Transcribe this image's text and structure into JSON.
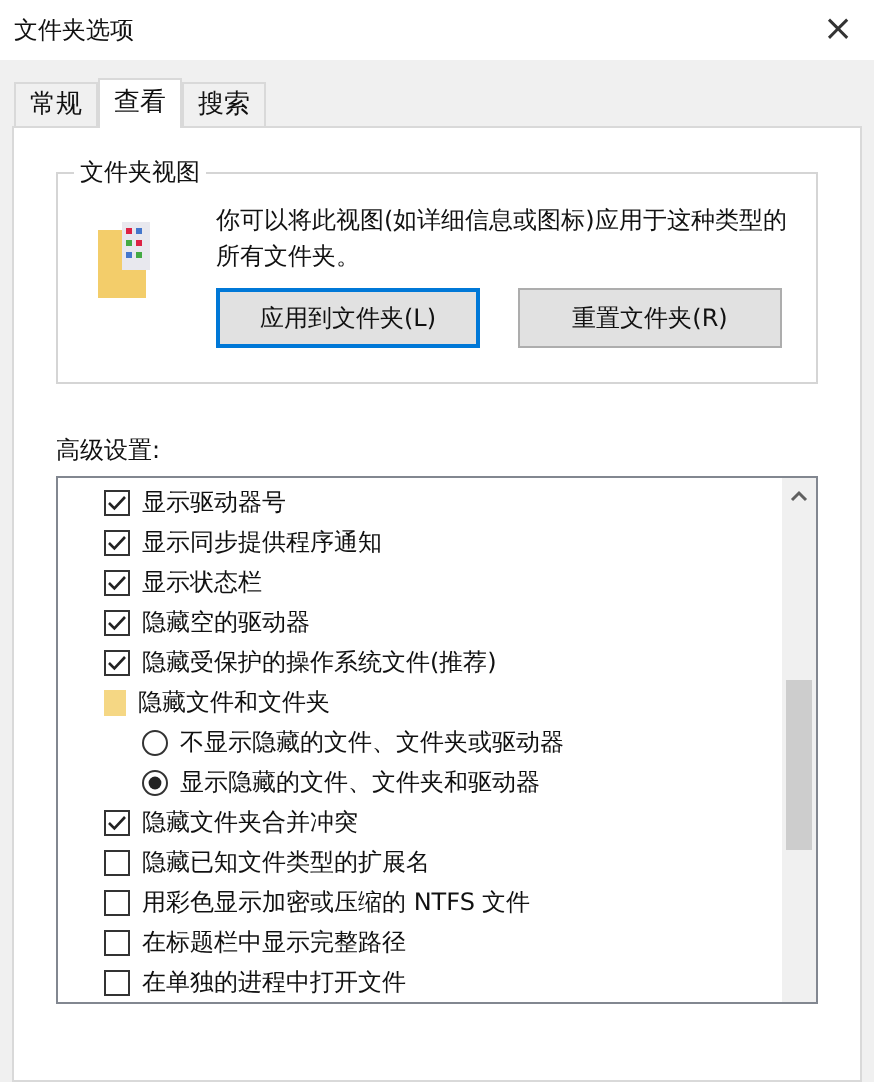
{
  "window": {
    "title": "文件夹选项",
    "close": "×"
  },
  "tabs": [
    {
      "label": "常规",
      "selected": false
    },
    {
      "label": "查看",
      "selected": true
    },
    {
      "label": "搜索",
      "selected": false
    }
  ],
  "folder_views": {
    "title": "文件夹视图",
    "description": "你可以将此视图(如详细信息或图标)应用于这种类型的所有文件夹。",
    "buttons": [
      {
        "label": "应用到文件夹(L)",
        "focused": true
      },
      {
        "label": "重置文件夹(R)",
        "focused": false
      }
    ]
  },
  "advanced": {
    "label": "高级设置:",
    "items": [
      {
        "kind": "checkbox",
        "label": "显示驱动器号",
        "checked": true
      },
      {
        "kind": "checkbox",
        "label": "显示同步提供程序通知",
        "checked": true
      },
      {
        "kind": "checkbox",
        "label": "显示状态栏",
        "checked": true
      },
      {
        "kind": "checkbox",
        "label": "隐藏空的驱动器",
        "checked": true
      },
      {
        "kind": "checkbox",
        "label": "隐藏受保护的操作系统文件(推荐)",
        "checked": true
      },
      {
        "kind": "folder",
        "label": "隐藏文件和文件夹",
        "children": [
          {
            "kind": "radio",
            "label": "不显示隐藏的文件、文件夹或驱动器",
            "selected": false
          },
          {
            "kind": "radio",
            "label": "显示隐藏的文件、文件夹和驱动器",
            "selected": true
          }
        ]
      },
      {
        "kind": "checkbox",
        "label": "隐藏文件夹合并冲突",
        "checked": true
      },
      {
        "kind": "checkbox",
        "label": "隐藏已知文件类型的扩展名",
        "checked": false
      },
      {
        "kind": "checkbox",
        "label": "用彩色显示加密或压缩的 NTFS 文件",
        "checked": false
      },
      {
        "kind": "checkbox",
        "label": "在标题栏中显示完整路径",
        "checked": false
      },
      {
        "kind": "checkbox",
        "label": "在单独的进程中打开文件",
        "checked": false
      }
    ]
  }
}
